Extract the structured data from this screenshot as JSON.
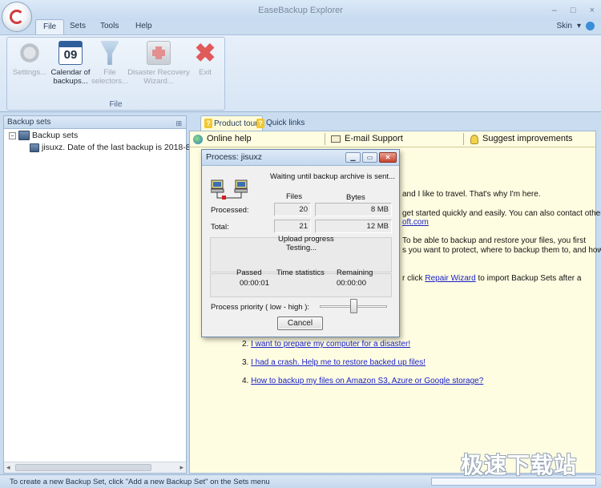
{
  "window": {
    "title": "EaseBackup Explorer",
    "controls": [
      "–",
      "□",
      "×"
    ]
  },
  "ribbon": {
    "tabs": [
      "File",
      "Sets",
      "Tools",
      "Help"
    ],
    "active_tab": "File",
    "skin_label": "Skin",
    "group_label": "File",
    "buttons": [
      {
        "line1": "Settings...",
        "line2": "",
        "icon": "gear-icon",
        "enabled": false
      },
      {
        "line1": "Calendar of",
        "line2": "backups...",
        "icon": "calendar-icon",
        "enabled": true,
        "icon_text": "09"
      },
      {
        "line1": "File",
        "line2": "selectors...",
        "icon": "filter-icon",
        "enabled": false
      },
      {
        "line1": "Disaster Recovery",
        "line2": "Wizard...",
        "icon": "first-aid-kit-icon",
        "enabled": false
      },
      {
        "line1": "Exit",
        "line2": "",
        "icon": "exit-x-icon",
        "enabled": false
      }
    ]
  },
  "left_panel": {
    "header": "Backup sets",
    "pin": "⊞",
    "tree": {
      "root_expander": "−",
      "root_label": "Backup sets",
      "child_label": "jisuxz. Date of the last backup is 2018-8"
    }
  },
  "right_panel": {
    "tabs": [
      {
        "label": "Product tour",
        "active": true
      },
      {
        "label": "Quick links",
        "active": false
      }
    ],
    "links": [
      {
        "label": "Online help",
        "icon": "globe-icon"
      },
      {
        "label": "E-mail Support",
        "icon": "mail-icon"
      },
      {
        "label": "Suggest improvements",
        "icon": "lightbulb-icon"
      }
    ],
    "fragments": {
      "f1": "and I like to travel. That's why I'm here.",
      "f2": "get started quickly and easily. You can also contact other",
      "f3": "oft.com",
      "f4": "To be able to backup and restore your files, you first",
      "f5": "s you want to protect, where to backup them to, and how",
      "f6a": "r click",
      "f6link": "Repair Wizard",
      "f6b": "to import Backup Sets after a"
    },
    "items": [
      {
        "num": "2.",
        "text": "I want to prepare my computer for a disaster!"
      },
      {
        "num": "3.",
        "text": "I had a crash. Help me to restore backed up files!"
      },
      {
        "num": "4.",
        "text": "How to backup my files on Amazon S3, Azure or Google storage?"
      }
    ]
  },
  "dialog": {
    "title": "Process:  jisuxz",
    "status": "Waiting until backup archive is sent...",
    "col_files": "Files",
    "col_bytes": "Bytes",
    "processed_label": "Processed:",
    "processed_files": "20",
    "processed_bytes": "8 MB",
    "total_label": "Total:",
    "total_files": "21",
    "total_bytes": "12 MB",
    "upload_label": "Upload progress",
    "upload_status": "Testing...",
    "passed_label": "Passed",
    "passed_value": "00:00:01",
    "time_stats_label": "Time statistics",
    "remaining_label": "Remaining",
    "remaining_value": "00:00:00",
    "priority_label": "Process priority ( low - high ):",
    "priority_fraction": 0.5,
    "cancel_label": "Cancel"
  },
  "statusbar": {
    "text": "To create a new Backup Set, click \"Add a new Backup Set\" on the Sets menu"
  },
  "watermark": "极速下载站"
}
